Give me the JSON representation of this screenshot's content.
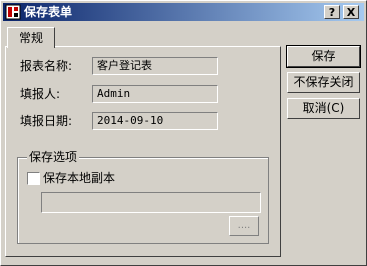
{
  "window": {
    "title": "保存表单",
    "help_label": "?",
    "close_label": "X"
  },
  "tabs": [
    {
      "label": "常规"
    }
  ],
  "form": {
    "report_name_label": "报表名称:",
    "report_name_value": "客户登记表",
    "reporter_label": "填报人:",
    "reporter_value": "Admin",
    "date_label": "填报日期:",
    "date_value": "2014-09-10"
  },
  "options": {
    "group_label": "保存选项",
    "local_copy_label": "保存本地副本",
    "local_copy_checked": false,
    "path_value": "",
    "browse_label": "...."
  },
  "buttons": {
    "save": "保存",
    "dont_save_close": "不保存关闭",
    "cancel": "取消(C)"
  },
  "colors": {
    "titlebar_start": "#0a246a",
    "titlebar_end": "#a6caf0",
    "face": "#d4d0c8"
  },
  "icons": {
    "app": "app-icon"
  }
}
